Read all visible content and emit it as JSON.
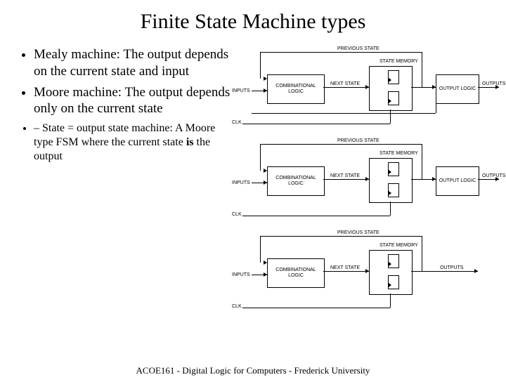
{
  "title": "Finite State Machine types",
  "bullets": {
    "mealy": "Mealy machine: The output depends on the current state and input",
    "moore": "Moore machine: The output depends only on the current state",
    "sub_pre": "State = output state machine: A Moore type FSM where the current state ",
    "sub_bold": "is",
    "sub_post": " the output"
  },
  "labels": {
    "previous_state": "PREVIOUS STATE",
    "state_memory": "STATE MEMORY",
    "inputs": "INPUTS",
    "comb_logic": "COMBINATIONAL LOGIC",
    "next_state": "NEXT STATE",
    "output_logic": "OUTPUT LOGIC",
    "outputs": "OUTPUTS",
    "clk": "CLK"
  },
  "footer": "ACOE161 - Digital Logic for Computers - Frederick University"
}
